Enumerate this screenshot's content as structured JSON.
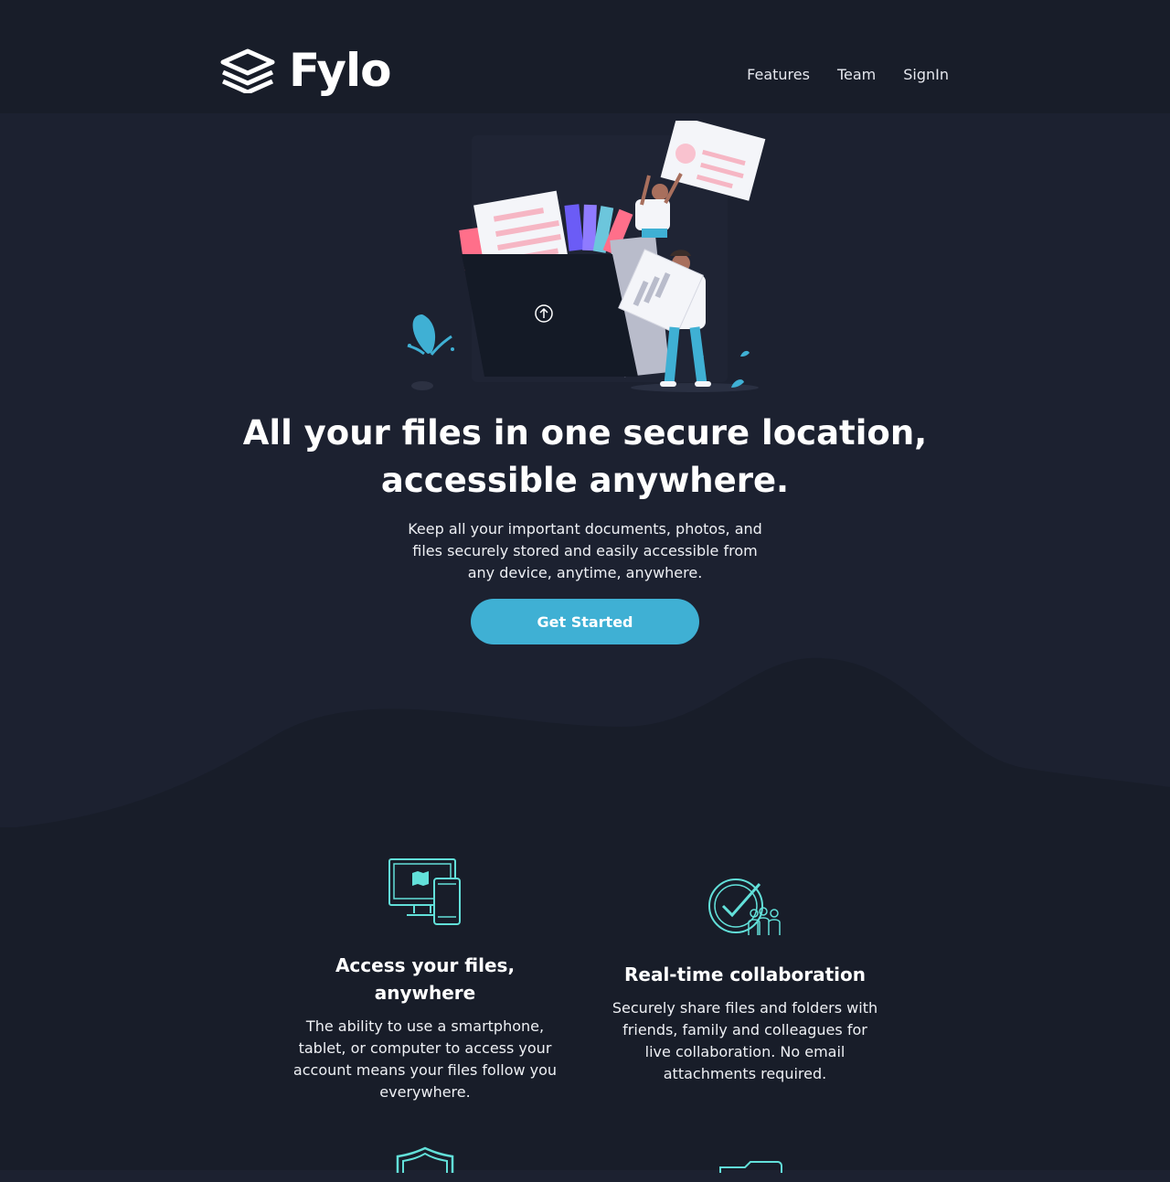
{
  "brand": {
    "name": "Fylo"
  },
  "nav": {
    "features": "Features",
    "team": "Team",
    "signin": "SignIn"
  },
  "hero": {
    "title": "All your files in one secure location, accessible anywhere.",
    "subtitle": "Keep all your important documents, photos, and files securely stored and easily accessible from any device, anytime, anywhere.",
    "cta": "Get Started"
  },
  "features": [
    {
      "icon": "access-anywhere-icon",
      "title": "Access your files, anywhere",
      "body": "The ability to use a smartphone, tablet, or computer to access your account means your files follow you everywhere."
    },
    {
      "icon": "collaboration-icon",
      "title": "Real-time collaboration",
      "body": "Securely share files and folders with friends, family and colleagues for live collaboration. No email attachments required."
    }
  ],
  "colors": {
    "background": "#1c2130",
    "header": "#181d29",
    "accent": "#3fb0d4",
    "icon": "#62e0d9"
  }
}
